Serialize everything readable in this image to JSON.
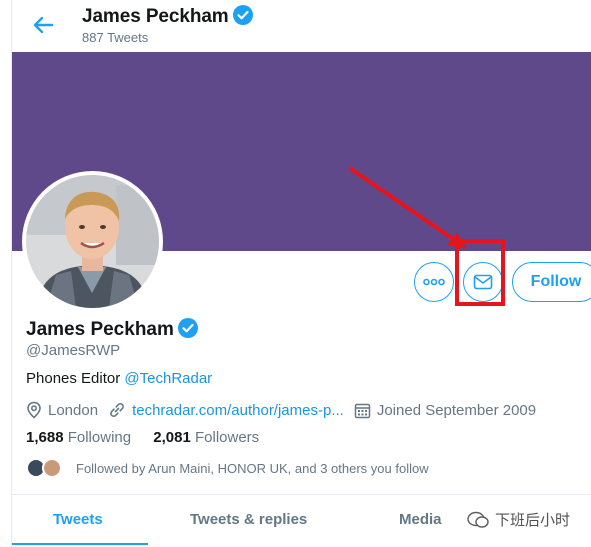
{
  "header": {
    "name": "James Peckham",
    "tweet_count": "887 Tweets"
  },
  "profile": {
    "name": "James Peckham",
    "handle": "@JamesRWP",
    "bio_prefix": "Phones Editor ",
    "bio_mention": "@TechRadar",
    "location": "London",
    "website": "techradar.com/author/james-p...",
    "joined": "Joined September 2009",
    "following_count": "1,688",
    "following_label": "Following",
    "followers_count": "2,081",
    "followers_label": "Followers",
    "followed_by": "Followed by Arun Maini, HONOR UK, and 3 others you follow"
  },
  "actions": {
    "follow_label": "Follow"
  },
  "tabs": [
    {
      "label": "Tweets",
      "active": true
    },
    {
      "label": "Tweets & replies",
      "active": false
    },
    {
      "label": "Media",
      "active": false
    }
  ],
  "watermark": "下班后小时",
  "colors": {
    "accent": "#1da1f2",
    "banner": "#5f498b",
    "annotation": "#e8141b"
  }
}
